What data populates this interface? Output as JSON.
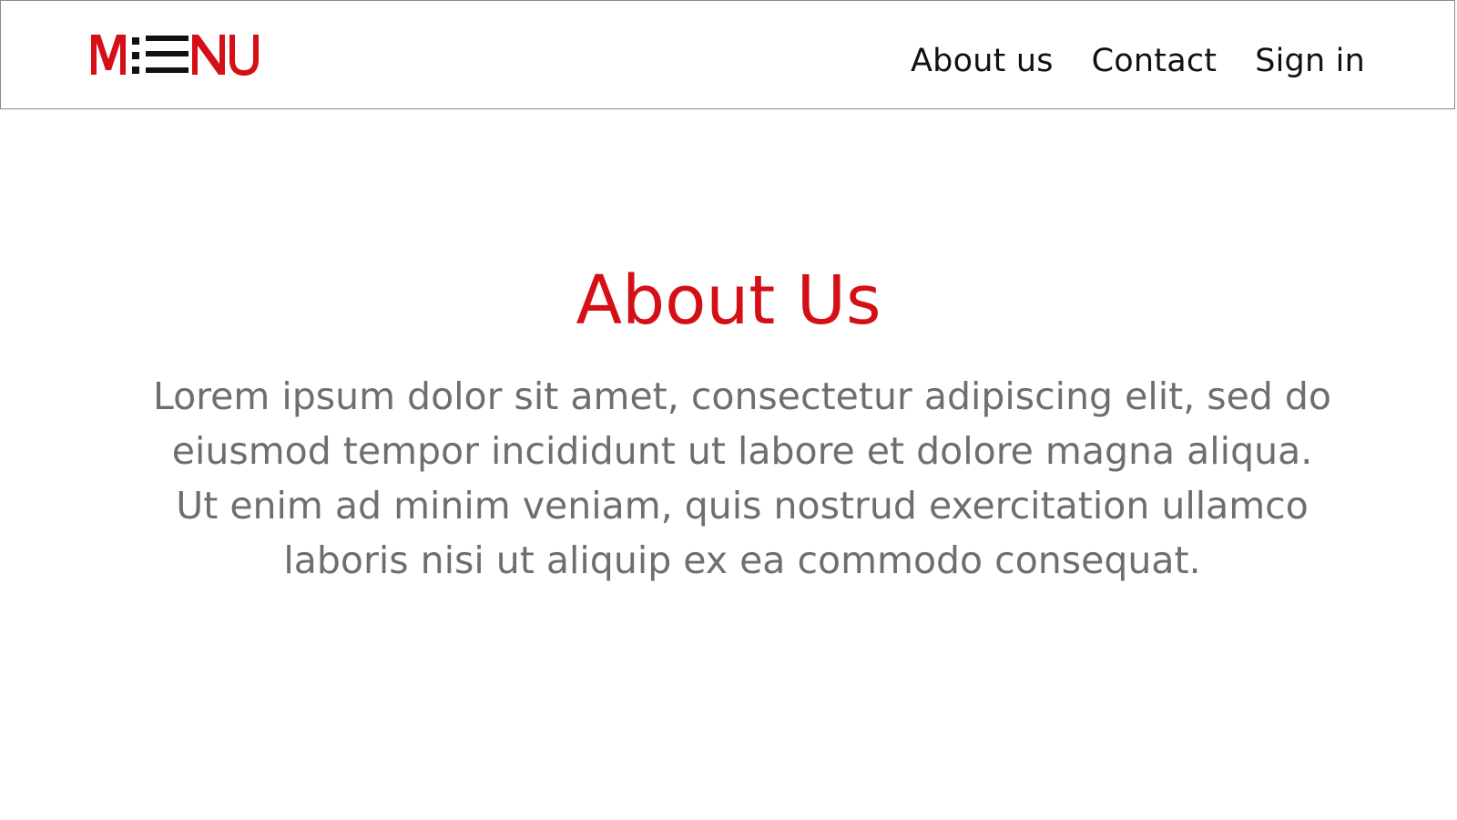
{
  "header": {
    "logo": {
      "text": "MENU",
      "icon": "menu-hamburger-icon",
      "brand_color": "#d50f16"
    },
    "nav": [
      {
        "label": "About us"
      },
      {
        "label": "Contact"
      },
      {
        "label": "Sign in"
      }
    ]
  },
  "main": {
    "title": "About Us",
    "paragraph": "Lorem ipsum dolor sit amet, consectetur adipiscing elit, sed do eiusmod tempor incididunt ut labore et dolore magna aliqua. Ut enim ad minim veniam, quis nostrud exercitation ullamco laboris nisi ut aliquip ex ea commodo consequat."
  },
  "colors": {
    "accent": "#d50f16",
    "text_dark": "#111111",
    "text_muted": "#6e6e6e",
    "border": "#8a8a8a"
  }
}
